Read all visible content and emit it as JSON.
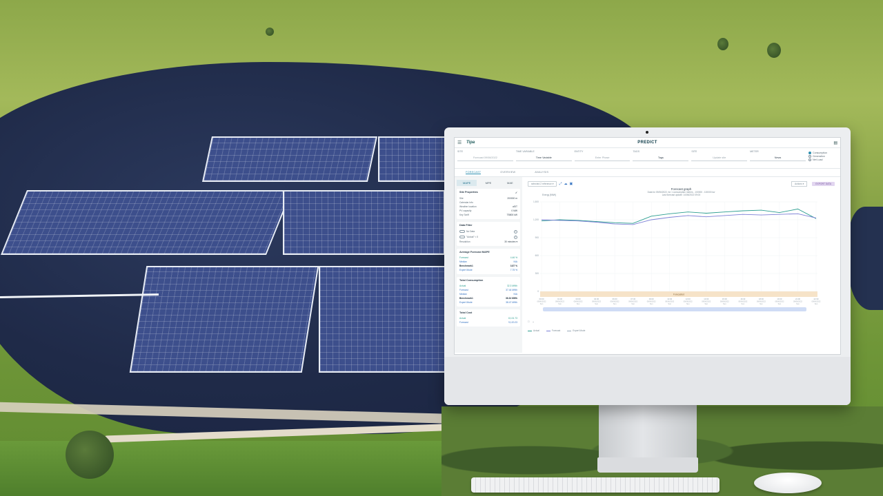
{
  "app": {
    "logo": "Tipa",
    "title": "PREDICT",
    "menu_icon": "menu-icon",
    "corner_icon": "calendar-icon"
  },
  "filters": [
    {
      "label": "SITE",
      "value": "Forecast 09/06/2022",
      "dark": false
    },
    {
      "label": "TIME VARIABLE",
      "value": "Time Variable",
      "dark": true
    },
    {
      "label": "ENTITY",
      "value": "Enter Phase",
      "dark": false
    },
    {
      "label": "TAGS",
      "value": "Tags",
      "dark": true
    },
    {
      "label": "SITE",
      "value": "Update site",
      "dark": false
    },
    {
      "label": "METER",
      "value": "News",
      "dark": true
    }
  ],
  "radios": [
    {
      "label": "Consumption",
      "selected": true
    },
    {
      "label": "Generation",
      "selected": false
    },
    {
      "label": "Net Load",
      "selected": false
    }
  ],
  "tabs": [
    {
      "label": "FORECAST",
      "active": true
    },
    {
      "label": "OVERVIEW",
      "active": false
    },
    {
      "label": "ANALYSIS",
      "active": false
    }
  ],
  "metric_tabs": [
    {
      "label": "MAPE",
      "active": true
    },
    {
      "label": "MPE",
      "active": false
    },
    {
      "label": "MAE",
      "active": false
    }
  ],
  "site_properties": {
    "title": "Site Properties",
    "rows": [
      {
        "k": "Site",
        "v": "200000 m"
      },
      {
        "k": "Calendar Info",
        "v": ""
      },
      {
        "k": "Weather location",
        "v": "aSIT"
      },
      {
        "k": "PV capacity",
        "v": "0 MW"
      },
      {
        "k": "Key Tariff",
        "v": "TB800 kW"
      }
    ]
  },
  "data_filter": {
    "title": "Data Filter",
    "toggles": [
      "No Data",
      "\"Actual\" < 0"
    ],
    "resolution_label": "Resolution",
    "resolution_value": "30 minutes"
  },
  "average_mape": {
    "title": "Average Forecast MAPE",
    "rows": [
      {
        "k": "Forecast",
        "v": "4.46 %",
        "style": "teal"
      },
      {
        "k": "Median",
        "v": "N/A",
        "style": "blue"
      },
      {
        "k": "Benchmark1",
        "v": "3.87 %",
        "style": "bold"
      },
      {
        "k": "Expert Mode",
        "v": "7.75 %",
        "style": "blue"
      }
    ]
  },
  "total_consumption": {
    "title": "Total Consumption",
    "rows": [
      {
        "k": "Actual",
        "v": "32.3 MWh",
        "style": "teal"
      },
      {
        "k": "Forecast",
        "v": "37.44 MWh",
        "style": "blue"
      },
      {
        "k": "Median",
        "v": "N/A",
        "style": "blue"
      },
      {
        "k": "Benchmark1",
        "v": "36.34 MWh",
        "style": "bold"
      },
      {
        "k": "Expert Mode",
        "v": "38.47 MWh",
        "style": "blue"
      }
    ]
  },
  "total_cost": {
    "title": "Total Cost",
    "rows": [
      {
        "k": "Actual",
        "v": "8,101.73",
        "style": "teal"
      },
      {
        "k": "Forecast",
        "v": "9,120.23",
        "style": "blue"
      }
    ]
  },
  "chart_controls": {
    "select_label": "selected 2 reference",
    "actions_label": "Actions",
    "export_label": "EXPORT DATA"
  },
  "chart_data": {
    "type": "line",
    "title": "Forecast graph",
    "subtitle_1": "Data for 09/06/2022, for 1 consumption meters - 100000 - 100000 kw",
    "subtitle_2": "Last forecast update: 14/06/2022 09:00",
    "ylabel": "Energy [MWh]",
    "yticks": [
      "1,500",
      "1,200",
      "900",
      "600",
      "300",
      "0"
    ],
    "ylim": [
      0,
      1500
    ],
    "band_label": "Forecasted",
    "x": [
      "00:00",
      "01:30",
      "03:00",
      "04:30",
      "06:00",
      "07:30",
      "09:00",
      "10:30",
      "12:00",
      "13:30",
      "15:00",
      "16:30",
      "18:00",
      "19:30",
      "21:00",
      "22:30"
    ],
    "x_date": "09/06/2022",
    "x_day": "Sun",
    "series": [
      {
        "name": "Actual",
        "color": "#2a9d8f",
        "values": [
          1180,
          1200,
          1190,
          1170,
          1150,
          1140,
          1260,
          1300,
          1330,
          1310,
          1330,
          1350,
          1360,
          1320,
          1380,
          1220
        ]
      },
      {
        "name": "Forecast",
        "color": "#7b7fd6",
        "values": [
          1200,
          1190,
          1180,
          1160,
          1130,
          1120,
          1200,
          1240,
          1270,
          1250,
          1270,
          1290,
          1280,
          1290,
          1300,
          1230
        ]
      }
    ],
    "legend": [
      "Actual",
      "Forecast",
      "Expert Mode"
    ]
  }
}
